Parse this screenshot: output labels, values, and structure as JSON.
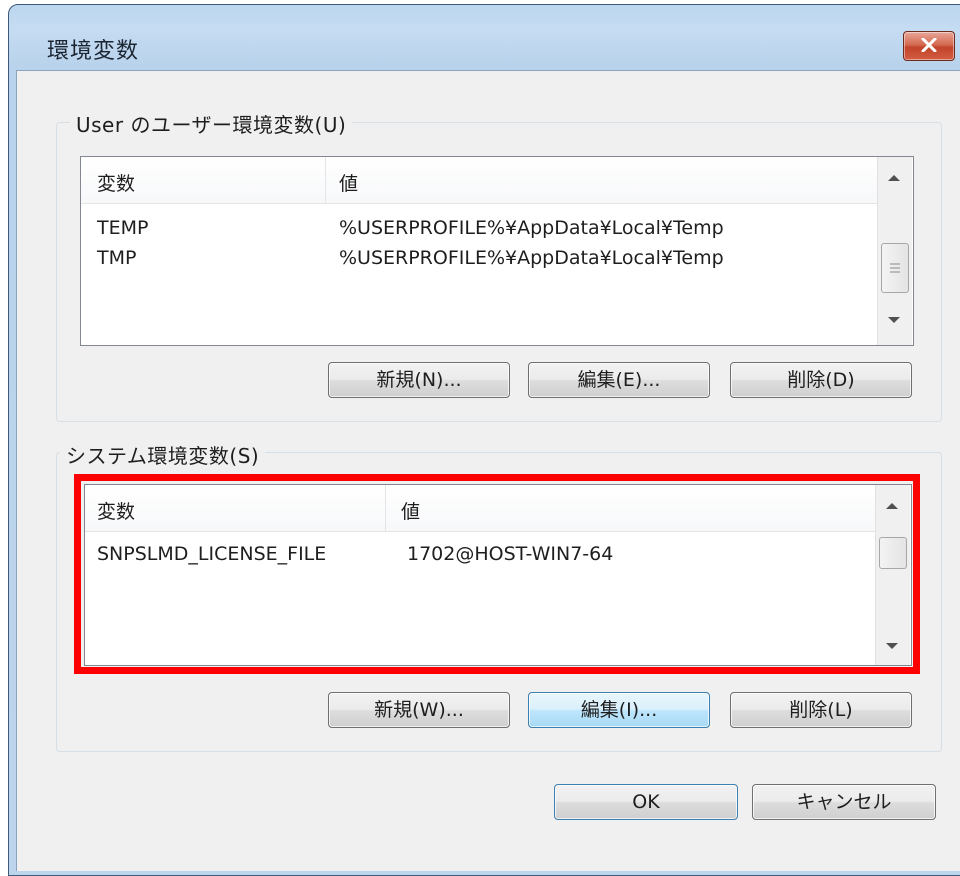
{
  "window": {
    "title": "環境変数"
  },
  "user_group": {
    "legend": "User のユーザー環境変数(U)",
    "columns": {
      "variable": "変数",
      "value": "値"
    },
    "rows": [
      {
        "variable": "TEMP",
        "value": "%USERPROFILE%¥AppData¥Local¥Temp"
      },
      {
        "variable": "TMP",
        "value": "%USERPROFILE%¥AppData¥Local¥Temp"
      }
    ],
    "buttons": {
      "new": "新規(N)...",
      "edit": "編集(E)...",
      "delete": "削除(D)"
    }
  },
  "system_group": {
    "legend": "システム環境変数(S)",
    "columns": {
      "variable": "変数",
      "value": "値"
    },
    "rows": [
      {
        "variable": "SNPSLMD_LICENSE_FILE",
        "value": "1702@HOST-WIN7-64"
      }
    ],
    "buttons": {
      "new": "新規(W)...",
      "edit": "編集(I)...",
      "delete": "削除(L)"
    }
  },
  "footer": {
    "ok": "OK",
    "cancel": "キャンセル"
  },
  "colors": {
    "highlight": "#ff0000",
    "close_button": "#c2432a"
  }
}
